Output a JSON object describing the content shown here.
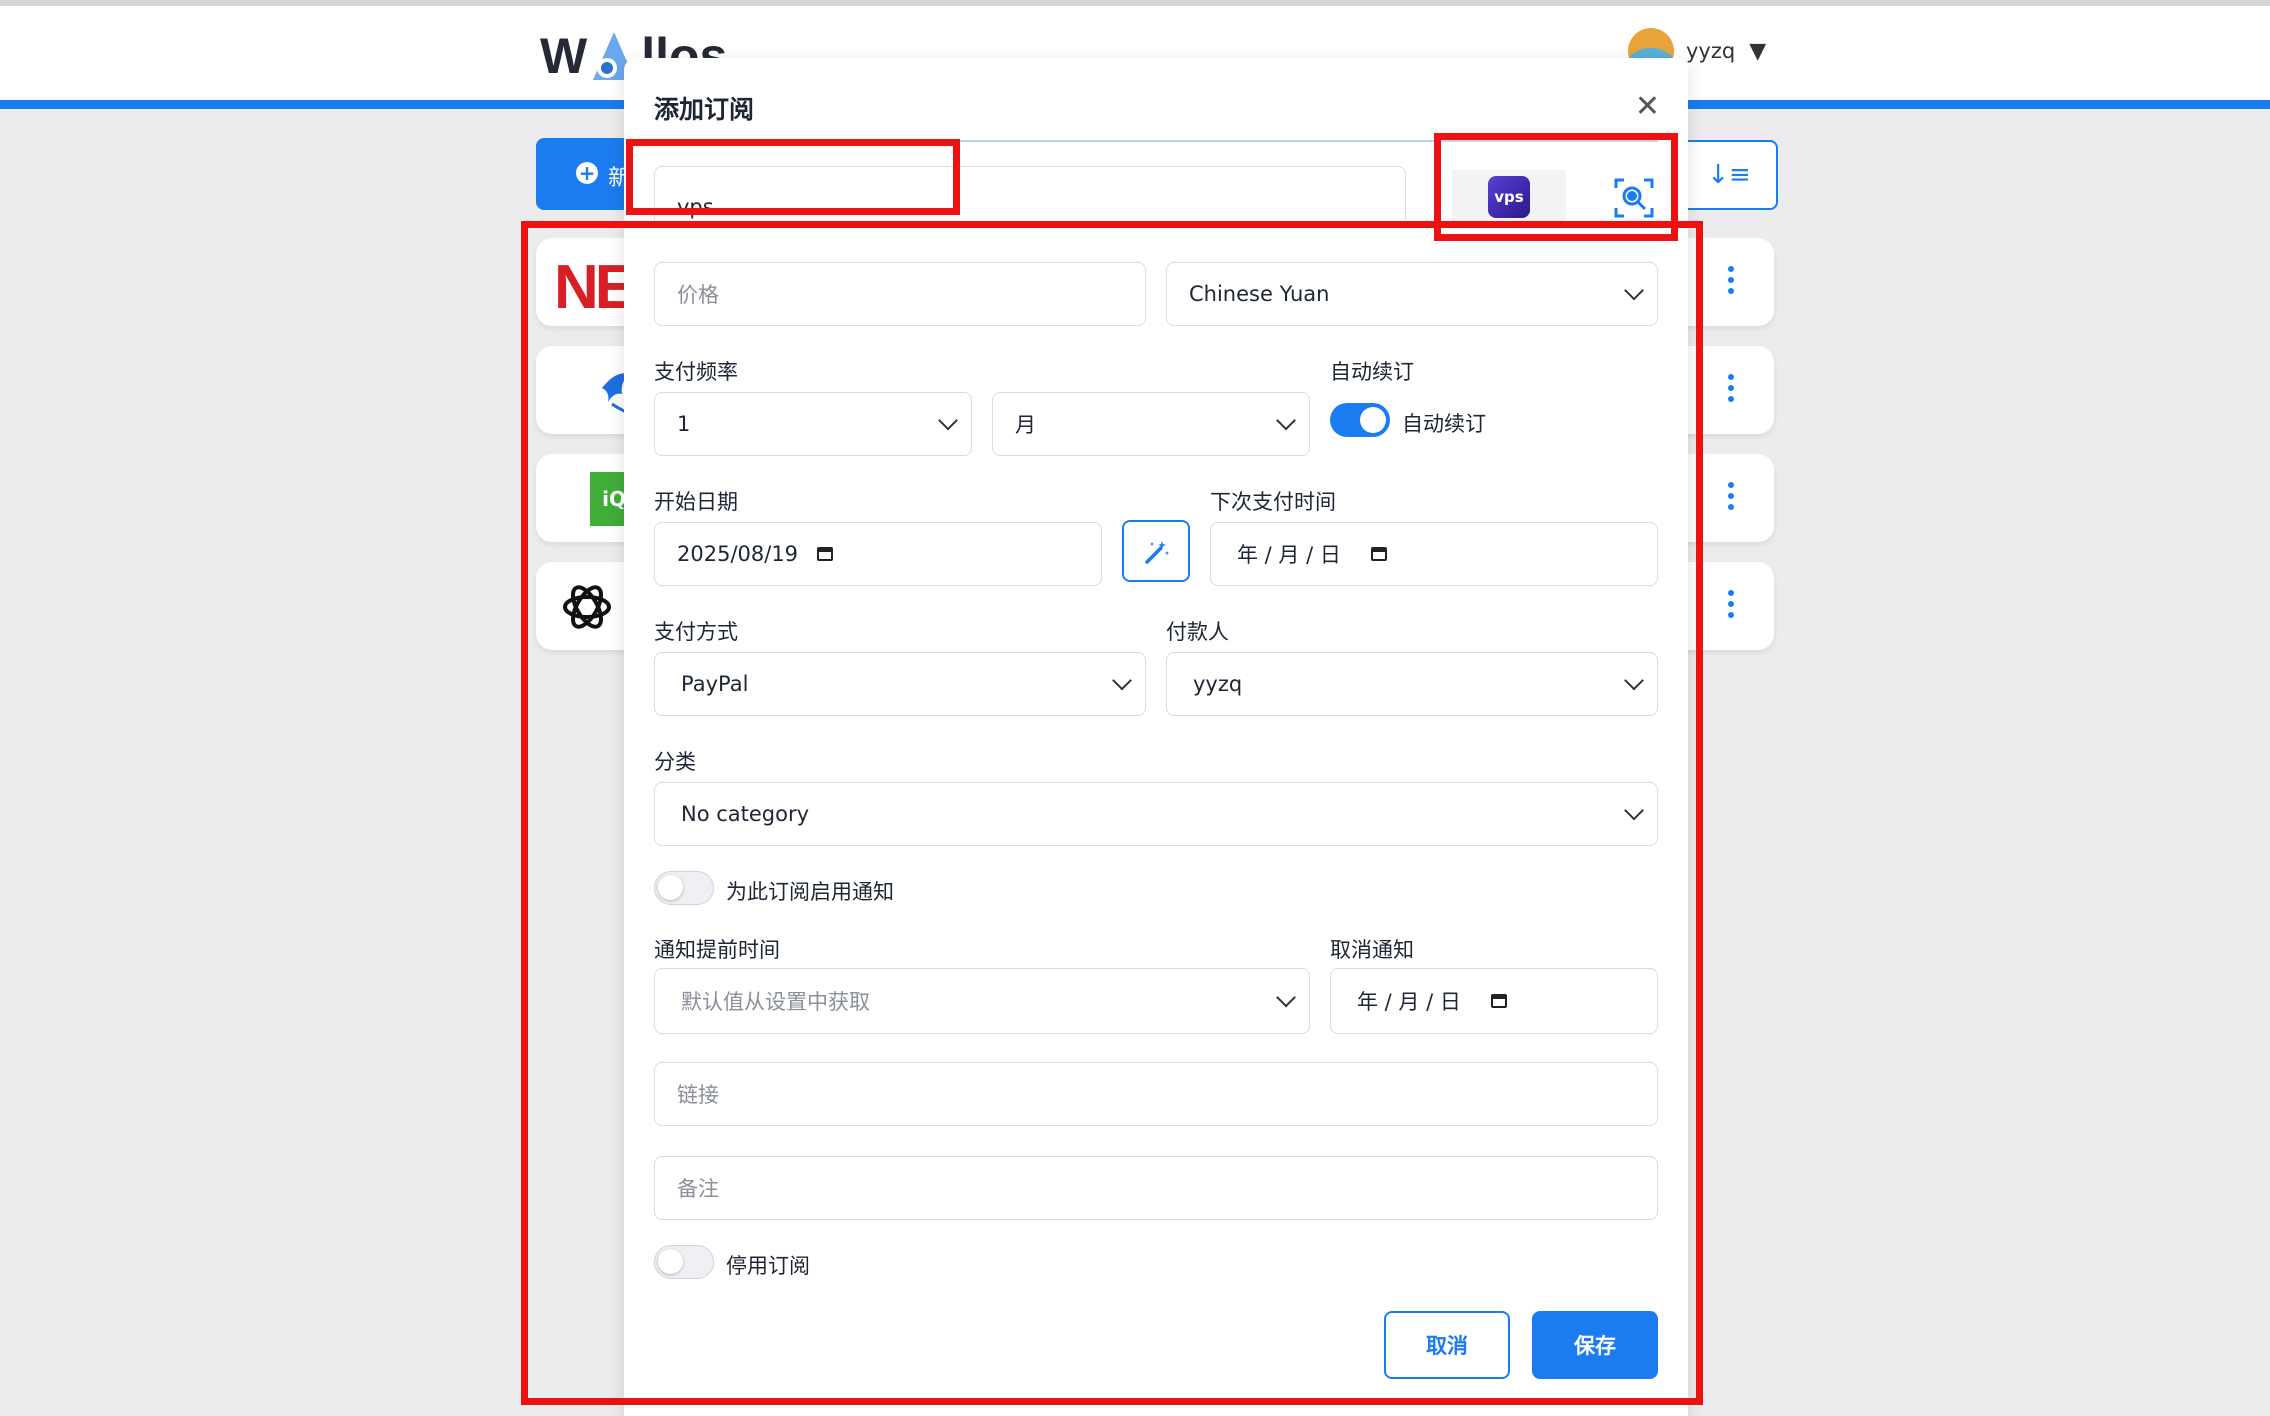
{
  "header": {
    "logo_text_left": "W",
    "logo_text_right": "llos",
    "username": "yyzq",
    "caret": "▼"
  },
  "background": {
    "add_button_label": "新",
    "sort_icon": "↓≡",
    "netflix_logo_text": "NE",
    "iq_logo_text": "iQ"
  },
  "modal": {
    "title": "添加订阅",
    "close_glyph": "✕",
    "name_value": "vps",
    "vps_badge_text": "vps",
    "price_placeholder": "价格",
    "currency": "Chinese Yuan",
    "pay_frequency_label": "支付频率",
    "frequency_count": "1",
    "frequency_unit": "月",
    "auto_renew_label": "自动续订",
    "auto_renew_toggle_label": "自动续订",
    "auto_renew_on": true,
    "start_date_label": "开始日期",
    "start_date_value": "2025/08/19",
    "next_payment_label": "下次支付时间",
    "next_payment_value": "年 / 月 / 日",
    "payment_method_label": "支付方式",
    "payment_method": "PayPal",
    "payer_label": "付款人",
    "payer": "yyzq",
    "category_label": "分类",
    "category": "No category",
    "notify_toggle_label": "为此订阅启用通知",
    "notify_on": false,
    "notify_advance_label": "通知提前时间",
    "notify_advance_placeholder": "默认值从设置中获取",
    "cancel_notify_label": "取消通知",
    "cancel_notify_value": "年 / 月 / 日",
    "link_placeholder": "链接",
    "notes_placeholder": "备注",
    "disable_toggle_label": "停用订阅",
    "disable_on": false,
    "cancel_button": "取消",
    "save_button": "保存"
  },
  "colors": {
    "accent": "#1a7cf0",
    "annotation": "#ee1111",
    "header_bar": "#1a7cf0"
  }
}
